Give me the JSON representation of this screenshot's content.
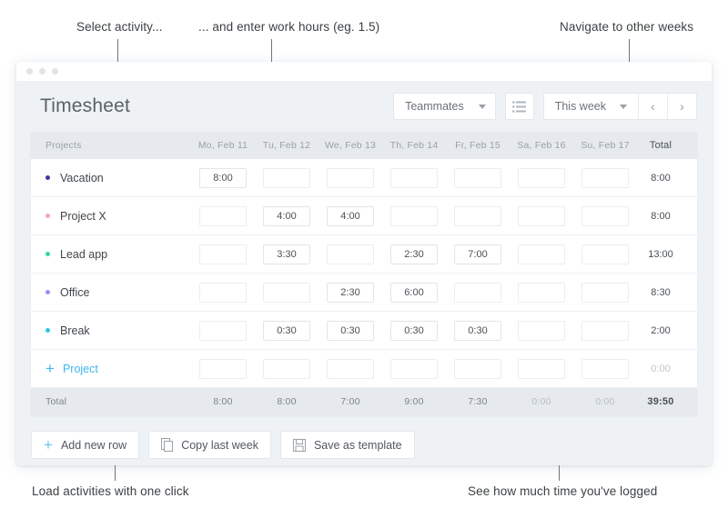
{
  "annotations": [
    {
      "id": "select-activity",
      "text": "Select activity..."
    },
    {
      "id": "enter-hours",
      "text": "... and enter work hours (eg. 1.5)"
    },
    {
      "id": "navigate-weeks",
      "text": "Navigate to other weeks"
    },
    {
      "id": "load-activities",
      "text": "Load activities with one click"
    },
    {
      "id": "time-logged",
      "text": "See how much time you've logged"
    }
  ],
  "window": {
    "title": "Timesheet",
    "toolbar": {
      "teammates_label": "Teammates",
      "list_view_icon": "list-icon",
      "week_label": "This week",
      "prev_icon": "chevron-left-icon",
      "next_icon": "chevron-right-icon",
      "prev_label": "‹",
      "next_label": "›"
    },
    "table": {
      "headers": {
        "projects": "Projects",
        "days": [
          "Mo, Feb 11",
          "Tu, Feb 12",
          "We, Feb 13",
          "Th, Feb 14",
          "Fr, Feb 15",
          "Sa, Feb 16",
          "Su, Feb 17"
        ],
        "total": "Total"
      },
      "rows": [
        {
          "name": "Vacation",
          "color": "#3d3a9e",
          "values": [
            "8:00",
            "",
            "",
            "",
            "",
            "",
            ""
          ],
          "total": "8:00",
          "delete_icon": "close-icon"
        },
        {
          "name": "Project X",
          "color": "#f79fd4",
          "values": [
            "",
            "4:00",
            "4:00",
            "",
            "",
            "",
            ""
          ],
          "total": "8:00",
          "delete_icon": "close-icon"
        },
        {
          "name": "Lead app",
          "color": "#33d6ad",
          "values": [
            "",
            "3:30",
            "",
            "2:30",
            "7:00",
            "",
            ""
          ],
          "total": "13:00",
          "delete_icon": "close-icon"
        },
        {
          "name": "Office",
          "color": "#9b93ea",
          "values": [
            "",
            "",
            "2:30",
            "6:00",
            "",
            "",
            ""
          ],
          "total": "8:30",
          "delete_icon": "close-icon"
        },
        {
          "name": "Break",
          "color": "#2ec8e6",
          "values": [
            "",
            "0:30",
            "0:30",
            "0:30",
            "0:30",
            "",
            ""
          ],
          "total": "2:00",
          "delete_icon": "close-icon"
        }
      ],
      "add_row": {
        "plus_icon": "plus-icon",
        "label": "Project",
        "values": [
          "",
          "",
          "",
          "",
          "",
          "",
          ""
        ],
        "total": "0:00",
        "delete_icon": "close-icon"
      },
      "footer": {
        "label": "Total",
        "values": [
          "8:00",
          "8:00",
          "7:00",
          "9:00",
          "7:30",
          "0:00",
          "0:00"
        ],
        "zero_flags": [
          false,
          false,
          false,
          false,
          false,
          true,
          true
        ],
        "total": "39:50"
      }
    },
    "actions": [
      {
        "icon": "plus-icon",
        "label": "Add new row"
      },
      {
        "icon": "copy-icon",
        "label": "Copy last week"
      },
      {
        "icon": "save-icon",
        "label": "Save as template"
      }
    ]
  },
  "cell_placeholder": ""
}
